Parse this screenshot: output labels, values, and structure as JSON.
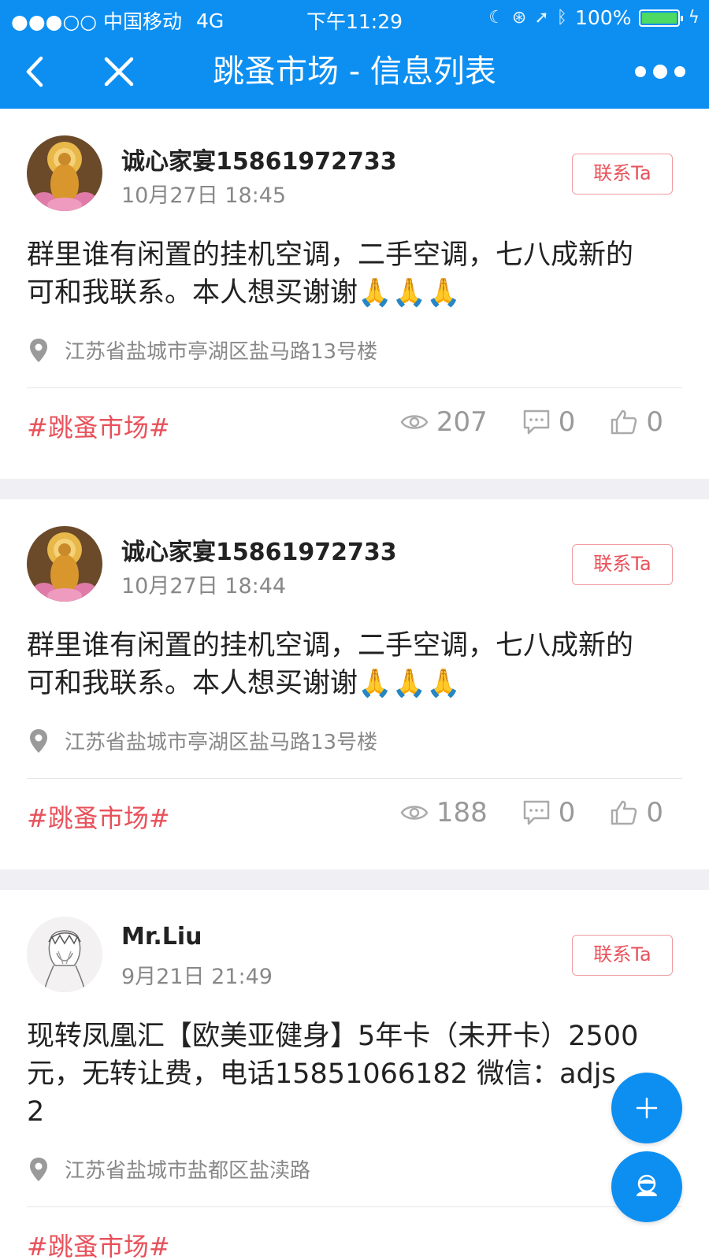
{
  "status_bar": {
    "carrier": "●●●○○ 中国移动",
    "network": "4G",
    "time": "下午11:29",
    "battery": "100%",
    "battery_level": 1.0
  },
  "nav": {
    "title": "跳蚤市场 - 信息列表"
  },
  "posts": [
    {
      "author": "诚心家宴15861972733",
      "time": "10月27日 18:45",
      "contact_label": "联系Ta",
      "content_line1": "群里谁有闲置的挂机空调，二手空调，七八成新的",
      "content_line2": "可和我联系。本人想买谢谢🙏🙏🙏",
      "location": "江苏省盐城市亭湖区盐马路13号楼",
      "tag": "#跳蚤市场#",
      "views": "207",
      "comments": "0",
      "likes": "0"
    },
    {
      "author": "诚心家宴15861972733",
      "time": "10月27日 18:44",
      "contact_label": "联系Ta",
      "content_line1": "群里谁有闲置的挂机空调，二手空调，七八成新的",
      "content_line2": "可和我联系。本人想买谢谢🙏🙏🙏",
      "location": "江苏省盐城市亭湖区盐马路13号楼",
      "tag": "#跳蚤市场#",
      "views": "188",
      "comments": "0",
      "likes": "0"
    },
    {
      "author": "Mr.Liu",
      "time": "9月21日 21:49",
      "contact_label": "联系Ta",
      "content_line1": "现转凤凰汇【欧美亚健身】5年卡（未开卡）2500",
      "content_line2": "元，无转让费，电话15851066182 微信：adjs",
      "content_line3": "2",
      "location": "江苏省盐城市盐都区盐渎路",
      "tag": "#跳蚤市场#"
    }
  ],
  "icons": {
    "back": "chevron-left-icon",
    "close": "close-icon",
    "more": "more-icon",
    "location": "location-pin-icon",
    "views": "eye-icon",
    "comments": "comment-icon",
    "likes": "thumbs-up-icon",
    "add": "plus-icon",
    "profile": "user-icon"
  },
  "colors": {
    "brand_blue": "#0d8ff2",
    "tag_red": "#e8515a",
    "muted_gray": "#888888",
    "battery_green": "#4cd964"
  }
}
